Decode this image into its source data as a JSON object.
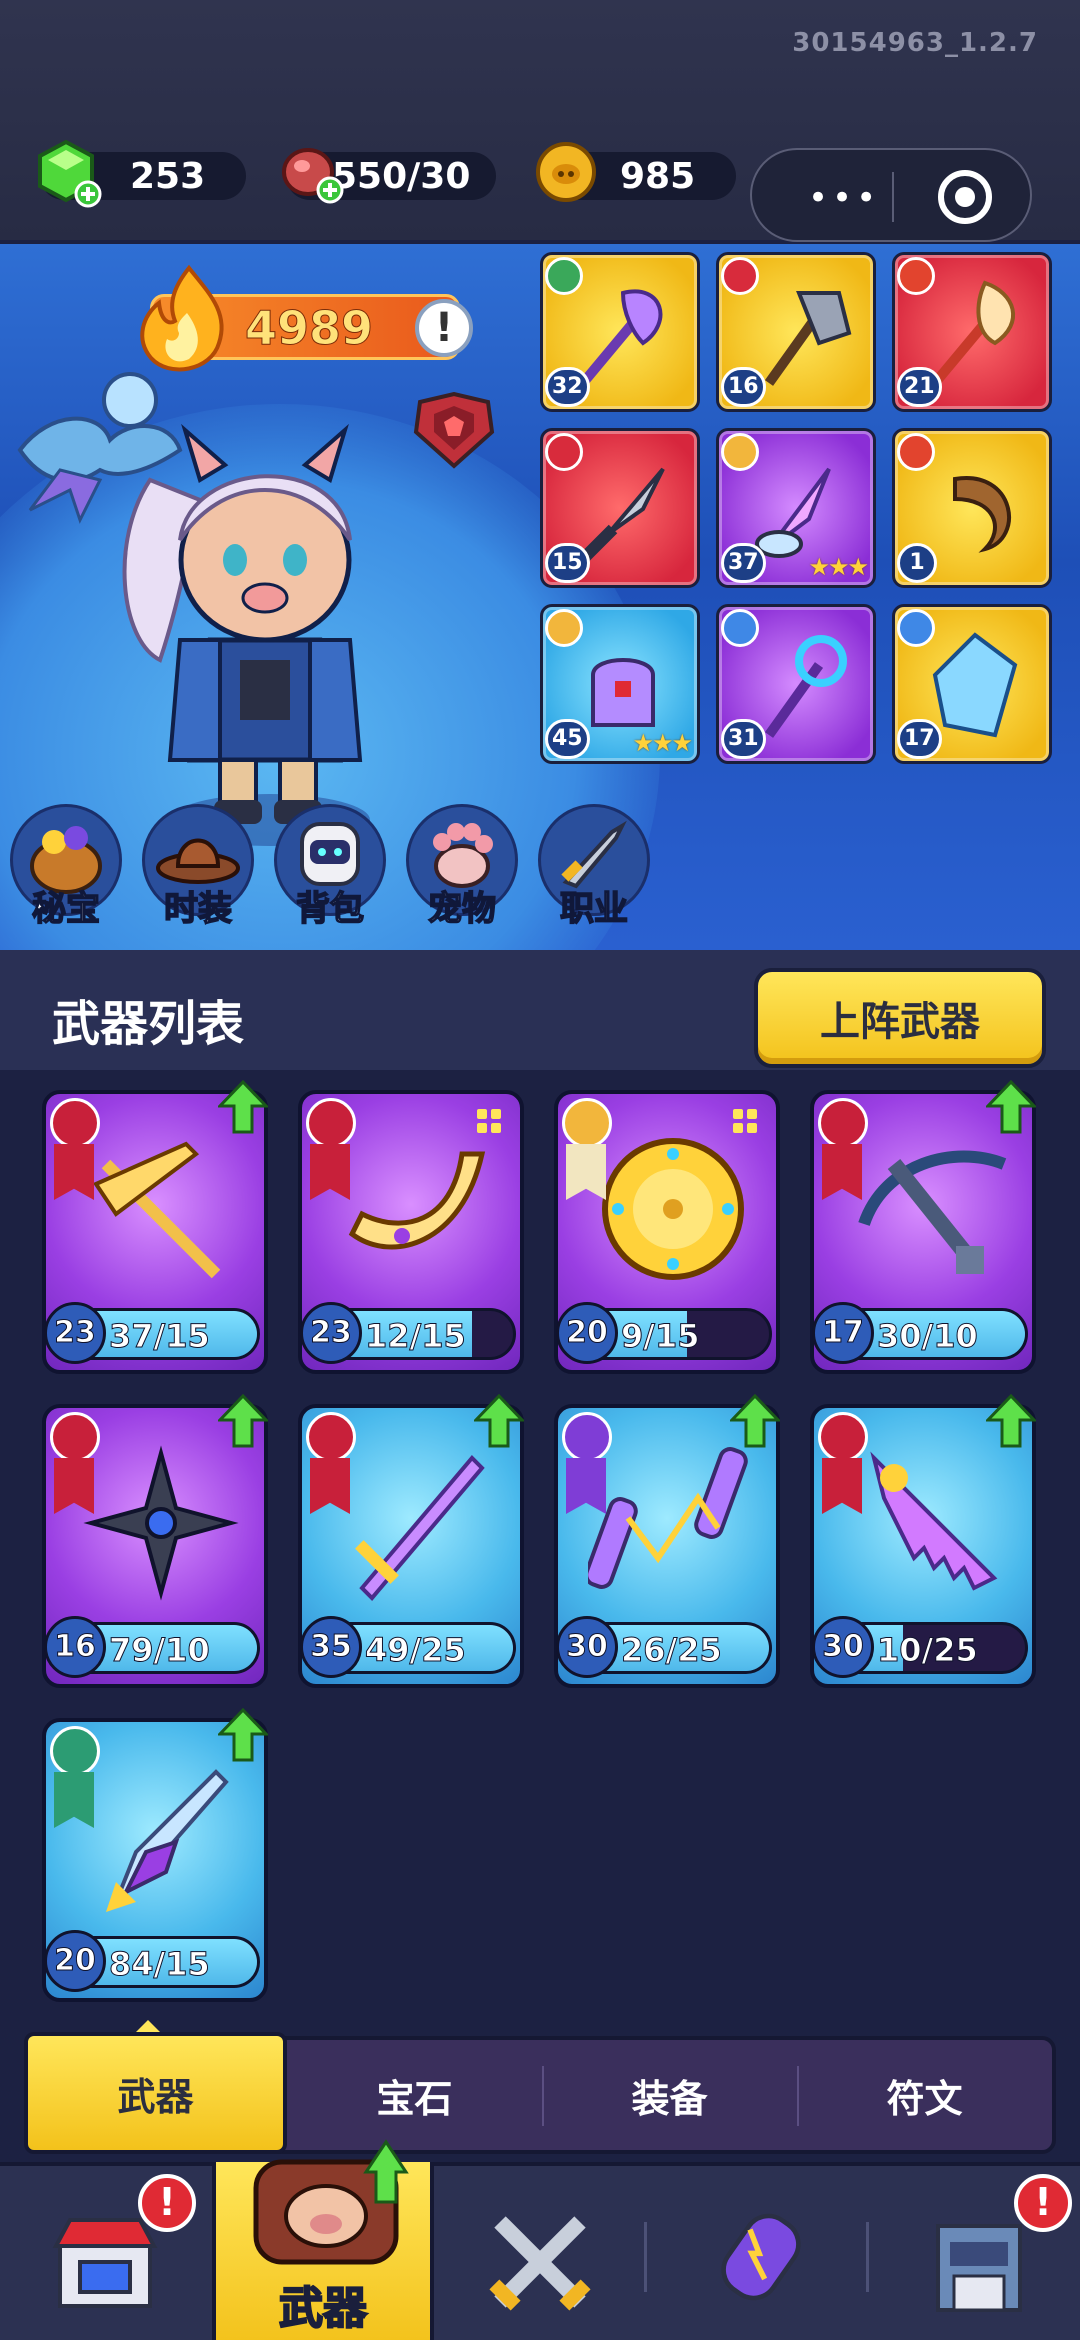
{
  "version": "30154963_1.2.7",
  "resources": {
    "gems": "253",
    "meat": "550/30",
    "coins": "985"
  },
  "hero": {
    "power": "4989",
    "info_mark": "!",
    "equipped": [
      {
        "level": "32",
        "color": "yellow",
        "element": "wind",
        "icon": "feather-staff-icon",
        "stars": ""
      },
      {
        "level": "16",
        "color": "yellow",
        "element": "attack",
        "icon": "axe-icon",
        "stars": ""
      },
      {
        "level": "21",
        "color": "red",
        "element": "fire",
        "icon": "feather-torch-icon",
        "stars": ""
      },
      {
        "level": "15",
        "color": "red",
        "element": "attack",
        "icon": "knife-icon",
        "stars": ""
      },
      {
        "level": "37",
        "color": "purple",
        "element": "holy",
        "icon": "drill-lance-icon",
        "stars": "★★★"
      },
      {
        "level": "1",
        "color": "yellow",
        "element": "fire",
        "icon": "horn-icon",
        "stars": ""
      },
      {
        "level": "45",
        "color": "blue",
        "element": "holy",
        "icon": "glove-icon",
        "stars": "★★★"
      },
      {
        "level": "31",
        "color": "purple",
        "element": "ice",
        "icon": "scepter-icon",
        "stars": ""
      },
      {
        "level": "17",
        "color": "yellow",
        "element": "ice",
        "icon": "crystal-icon",
        "stars": ""
      }
    ],
    "menu": [
      {
        "label": "秘宝",
        "icon": "treasure-pot-icon"
      },
      {
        "label": "时装",
        "icon": "cowboy-hat-icon"
      },
      {
        "label": "背包",
        "icon": "robot-backpack-icon"
      },
      {
        "label": "宠物",
        "icon": "paw-icon"
      },
      {
        "label": "职业",
        "icon": "sword-class-icon"
      }
    ]
  },
  "weapon_list": {
    "title": "武器列表",
    "deploy_button": "上阵武器",
    "items": [
      {
        "level": "23",
        "progress": "37/15",
        "fill": 1.0,
        "color": "purple",
        "upgrade": true,
        "icon": "golden-pitchfork-icon"
      },
      {
        "level": "23",
        "progress": "12/15",
        "fill": 0.8,
        "color": "purple",
        "upgrade": false,
        "icon": "boomerang-icon"
      },
      {
        "level": "20",
        "progress": "9/15",
        "fill": 0.6,
        "color": "purple",
        "upgrade": false,
        "icon": "golden-shield-icon"
      },
      {
        "level": "17",
        "progress": "30/10",
        "fill": 1.0,
        "color": "purple",
        "upgrade": true,
        "icon": "crossbow-icon"
      },
      {
        "level": "16",
        "progress": "79/10",
        "fill": 1.0,
        "color": "purple",
        "upgrade": true,
        "icon": "shuriken-icon"
      },
      {
        "level": "35",
        "progress": "49/25",
        "fill": 1.0,
        "color": "blue",
        "upgrade": true,
        "icon": "sword-icon"
      },
      {
        "level": "30",
        "progress": "26/25",
        "fill": 1.0,
        "color": "blue",
        "upgrade": true,
        "icon": "nunchaku-icon"
      },
      {
        "level": "30",
        "progress": "10/25",
        "fill": 0.4,
        "color": "blue",
        "upgrade": true,
        "icon": "serrated-blade-icon"
      },
      {
        "level": "20",
        "progress": "84/15",
        "fill": 1.0,
        "color": "blue",
        "upgrade": true,
        "icon": "crystal-spear-icon"
      }
    ]
  },
  "tabs": [
    "武器",
    "宝石",
    "装备",
    "符文"
  ],
  "bottom_nav": {
    "active_label": "武器",
    "badge": "!"
  }
}
